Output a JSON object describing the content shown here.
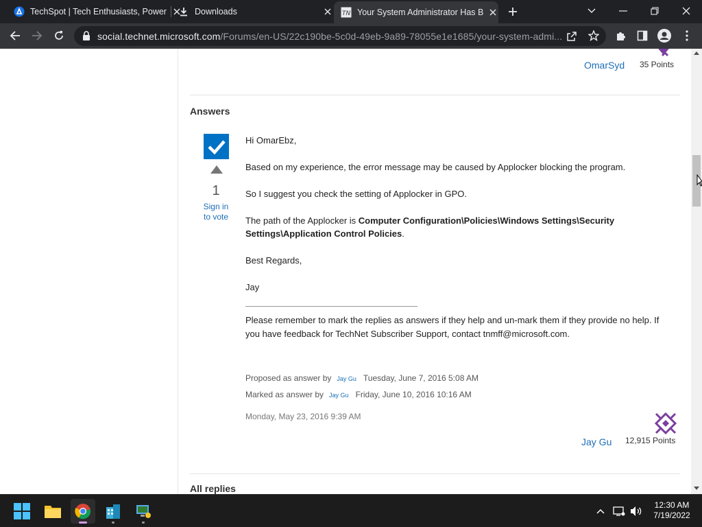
{
  "browser": {
    "tabs": [
      {
        "title": "TechSpot | Tech Enthusiasts, Power Users"
      },
      {
        "title": "Downloads"
      },
      {
        "title": "Your System Administrator Has Blocked"
      }
    ],
    "url_host": "social.technet.microsoft.com",
    "url_path": "/Forums/en-US/22c190be-5c0d-49eb-9a89-78055e1e1685/your-system-admi..."
  },
  "previous_post": {
    "author": "OmarSyd",
    "points": "35 Points"
  },
  "answers": {
    "heading": "Answers",
    "vote_count": "1",
    "vote_signin": "Sign in to vote",
    "greeting": "Hi OmarEbz,",
    "para1": "Based on my experience, the error message may be caused by Applocker blocking the program.",
    "para2": "So I suggest you check the setting of Applocker in GPO.",
    "path_prefix": "The path of the Applocker is ",
    "path_bold": "Computer Configuration\\Policies\\Windows Settings\\Security Settings\\Application Control Policies",
    "path_suffix": ".",
    "regards": "Best Regards,",
    "signature": "Jay",
    "footer_note": "Please remember to mark the replies as answers if they help and un-mark them if they provide no help. If you have feedback for TechNet Subscriber Support, contact tnmff@microsoft.com.",
    "proposed_label": "Proposed as answer by",
    "proposed_user": "Jay Gu",
    "proposed_date": "Tuesday, June 7, 2016 5:08 AM",
    "marked_label": "Marked as answer by",
    "marked_user": "Jay Gu",
    "marked_date": "Friday, June 10, 2016 10:16 AM",
    "post_date": "Monday, May 23, 2016 9:39 AM",
    "author": "Jay Gu",
    "points": "12,915 Points"
  },
  "all_replies_heading": "All replies",
  "taskbar": {
    "time": "12:30 AM",
    "date": "7/19/2022"
  },
  "colors": {
    "accent": "#0072c6",
    "link": "#1e6fb5",
    "avatar": "#7b3f9e"
  }
}
